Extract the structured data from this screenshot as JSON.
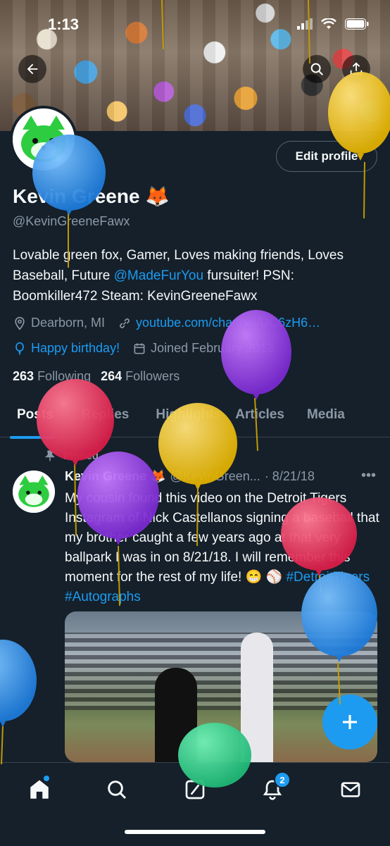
{
  "status_bar": {
    "time": "1:13"
  },
  "profile": {
    "edit_label": "Edit profile",
    "name": "Kevin Greene 🦊",
    "handle": "@KevinGreeneFawx",
    "bio_part1": "Lovable green fox, Gamer, Loves making friends, Loves Baseball, Future ",
    "bio_mention": "@MadeFurYou",
    "bio_part2": " fursuiter! PSN: Boomkiller472 Steam: KevinGreeneFawx",
    "location": "Dearborn, MI",
    "website": "youtube.com/channel/UC6zH6…",
    "birthday": "Happy birthday!",
    "joined": "Joined February 2013",
    "following_count": "263",
    "following_label": "Following",
    "followers_count": "264",
    "followers_label": "Followers"
  },
  "tabs": [
    {
      "label": "Posts"
    },
    {
      "label": "Replies"
    },
    {
      "label": "Highlights"
    },
    {
      "label": "Articles"
    },
    {
      "label": "Media"
    }
  ],
  "post": {
    "pinned_label": "Pinned",
    "author": "Kevin Greene 🦊",
    "handle": "@KevinGreen...",
    "date": "· 8/21/18",
    "text_main": "My cousin found this video on the Detroit Tigers Instagram of Nick Castellanos signing a baseball that my brother caught a few years ago at that very ballpark I was in on 8/21/18. I will remember this moment for the rest of my life! 😁 ⚾ ",
    "hashtags": "#DetroitTigers #Autographs"
  },
  "nav": {
    "notifications_badge": "2"
  },
  "colors": {
    "accent": "#1d9bf0",
    "background": "#15202b"
  },
  "icons": [
    "back-arrow-icon",
    "search-icon",
    "share-icon",
    "location-icon",
    "link-icon",
    "balloon-icon",
    "calendar-icon",
    "pin-icon",
    "more-icon",
    "plus-icon",
    "home-icon",
    "explore-icon",
    "grok-icon",
    "bell-icon",
    "mail-icon"
  ]
}
